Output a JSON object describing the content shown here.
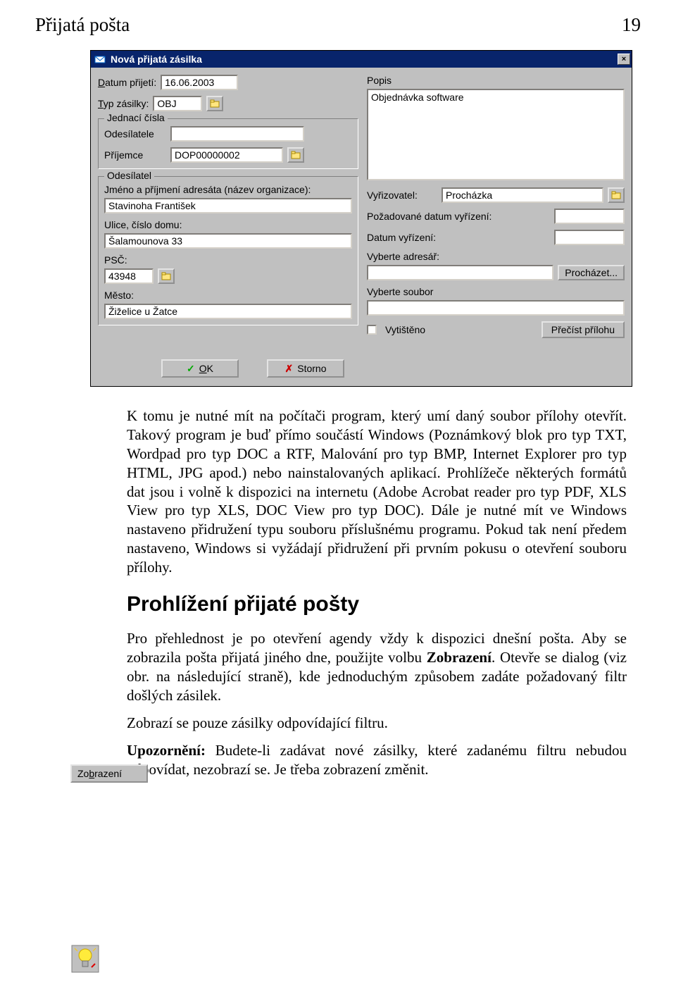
{
  "header": {
    "title": "Přijatá pošta",
    "page": "19"
  },
  "dialog": {
    "title": "Nová přijatá zásilka",
    "close": "×",
    "left": {
      "date_label": "Datum přijetí:",
      "date_underline": "D",
      "date_value": "16.06.2003",
      "type_label": "Typ zásilky:",
      "type_underline": "T",
      "type_value": "OBJ",
      "jednaci": {
        "legend": "Jednací čísla",
        "odesilatel_label": "Odesílatele",
        "odesilatel_value": "",
        "prijemce_label": "Příjemce",
        "prijemce_value": "DOP00000002"
      },
      "odesilatel": {
        "legend": "Odesílatel",
        "jmeno_label": "Jméno a příjmení adresáta (název organizace):",
        "jmeno_value": "Stavinoha František",
        "ulice_label": "Ulice, číslo domu:",
        "ulice_value": "Šalamounova 33",
        "psc_label": "PSČ:",
        "psc_value": "43948",
        "mesto_label": "Město:",
        "mesto_value": "Žiželice u Žatce"
      }
    },
    "right": {
      "popis_label": "Popis",
      "popis_value": "Objednávka software",
      "vyrizovatel_label": "Vyřizovatel:",
      "vyrizovatel_value": "Procházka",
      "pozadovane_label": "Požadované datum vyřízení:",
      "pozadovane_value": "",
      "datum_vyrizeni_label": "Datum vyřízení:",
      "datum_vyrizeni_value": "",
      "adresar_label": "Vyberte adresář:",
      "adresar_value": "",
      "prochazet_btn": "Procházet...",
      "soubor_label": "Vyberte soubor",
      "soubor_value": "",
      "vytisteno_label": "Vytištěno",
      "precist_btn": "Přečíst přílohu"
    },
    "footer": {
      "ok": "OK",
      "ok_underline": "O",
      "storno": "Storno"
    }
  },
  "article": {
    "p1": "K tomu je nutné mít na počítači program, který umí daný soubor přílohy otevřít. Takový program je buď přímo součástí Windows (Poznámkový blok pro typ TXT, Wordpad pro typ DOC a RTF, Malování pro typ BMP, Internet Explorer pro typ HTML, JPG apod.) nebo nainstalovaných aplikací. Prohlížeče některých formátů dat jsou i volně k dispozici na internetu (Adobe Acrobat reader pro typ PDF, XLS View pro typ XLS, DOC View pro typ DOC). Dále je nutné mít ve Windows nastaveno přidružení typu souboru příslušnému programu. Pokud tak není předem nastaveno, Windows si vyžádají přidružení při prvním pokusu o otevření souboru přílohy.",
    "h2": "Prohlížení přijaté pošty",
    "p2a": "Pro přehlednost je po otevření agendy vždy k dispozici dnešní pošta. Aby se zobrazila pošta přijatá jiného dne, použijte volbu ",
    "p2bold": "Zobrazení",
    "p2b": ". Otevře se dialog (viz obr. na následující straně), kde jednoduchým způsobem zadáte požadovaný filtr došlých zásilek.",
    "p3": "Zobrazí se pouze zásilky odpovídající filtru.",
    "p4a": "Upozornění:",
    "p4b": " Budete-li zadávat nové zásilky, které zadanému filtru nebudou odpovídat, nezobrazí se. Je třeba zobrazení změnit."
  },
  "margin": {
    "zobrazeni": "Zobrazení",
    "zobrazeni_underline": "b"
  }
}
